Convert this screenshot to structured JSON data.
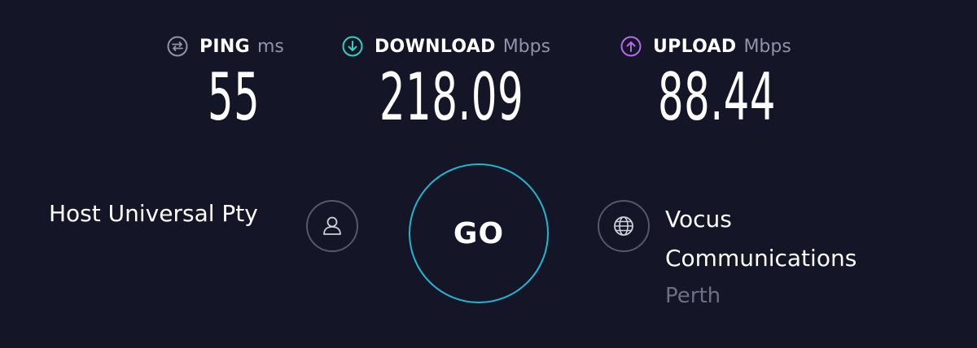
{
  "metrics": {
    "ping": {
      "label": "PING",
      "unit": "ms",
      "value": "55",
      "icon": "ping-icon",
      "color": "#9193a8"
    },
    "download": {
      "label": "DOWNLOAD",
      "unit": "Mbps",
      "value": "218.09",
      "icon": "download-arrow-icon",
      "color": "#2fd1c0"
    },
    "upload": {
      "label": "UPLOAD",
      "unit": "Mbps",
      "value": "88.44",
      "icon": "upload-arrow-icon",
      "color": "#b569e8"
    }
  },
  "host": {
    "name": "Host Universal Pty",
    "icon": "user-icon"
  },
  "go": {
    "label": "GO",
    "ring_color": "#1fb7cf"
  },
  "isp": {
    "name_line1": "Vocus",
    "name_line2": "Communications",
    "location": "Perth",
    "icon": "globe-icon"
  },
  "colors": {
    "background": "#141526",
    "muted": "#9193a8"
  }
}
